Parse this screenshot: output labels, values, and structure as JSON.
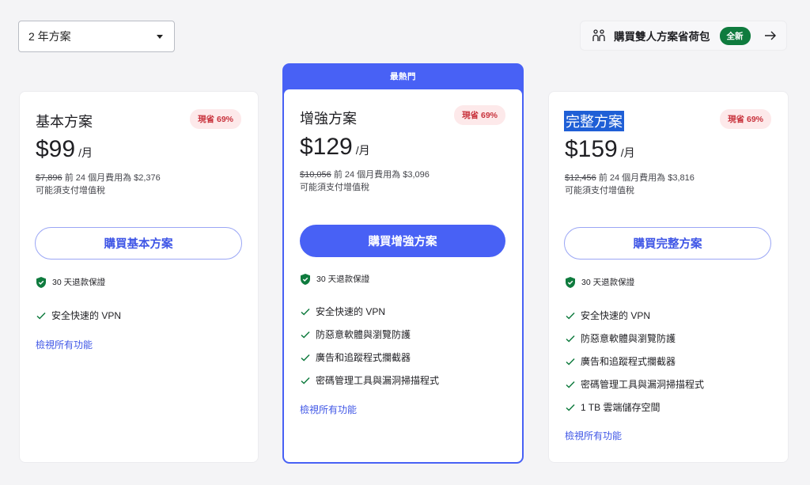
{
  "period_select": {
    "value": "2 年方案"
  },
  "duo_link": {
    "label": "購買雙人方案省荷包",
    "badge": "全新"
  },
  "plans": [
    {
      "name": "基本方案",
      "save_badge": "現省 69%",
      "price": "$99",
      "per": "/月",
      "orig_price": "$7,896",
      "billing_note": "前 24 個月費用為 $2,376",
      "tax_note": "可能須支付增值稅",
      "buy_label": "購買基本方案",
      "guarantee": "30 天退款保證",
      "features": [
        "安全快速的 VPN"
      ],
      "view_all": "檢視所有功能"
    },
    {
      "ribbon": "最熱門",
      "name": "增強方案",
      "save_badge": "現省 69%",
      "price": "$129",
      "per": "/月",
      "orig_price": "$10,056",
      "billing_note": "前 24 個月費用為 $3,096",
      "tax_note": "可能須支付增值稅",
      "buy_label": "購買增強方案",
      "guarantee": "30 天退款保證",
      "features": [
        "安全快速的 VPN",
        "防惡意軟體與瀏覽防護",
        "廣告和追蹤程式攔截器",
        "密碼管理工具與漏洞掃描程式"
      ],
      "view_all": "檢視所有功能"
    },
    {
      "name": "完整方案",
      "save_badge": "現省 69%",
      "price": "$159",
      "per": "/月",
      "orig_price": "$12,456",
      "billing_note": "前 24 個月費用為 $3,816",
      "tax_note": "可能須支付增值稅",
      "buy_label": "購買完整方案",
      "guarantee": "30 天退款保證",
      "features": [
        "安全快速的 VPN",
        "防惡意軟體與瀏覽防護",
        "廣告和追蹤程式攔截器",
        "密碼管理工具與漏洞掃描程式",
        "1 TB 雲端儲存空間"
      ],
      "view_all": "檢視所有功能"
    }
  ],
  "colors": {
    "accent": "#4861f5",
    "check": "#0f7b3e",
    "save_badge_bg": "#fde9ea",
    "save_badge_text": "#c8323c",
    "selection_highlight": "#1f5fd6"
  }
}
